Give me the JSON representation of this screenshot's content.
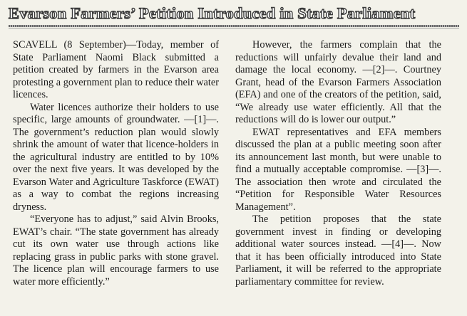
{
  "headline": "Evarson Farmers’ Petition Introduced in State Parliament",
  "left_column": [
    "SCAVELL (8 September)—Today, member of State Parliament Naomi Black submitted a petition created by farmers in the Evarson area protesting a government plan to reduce their water licences.",
    "Water licences authorize their holders to use specific, large amounts of groundwater. —[1]—. The government’s reduction plan would slowly shrink the amount of water that licence-holders in the agricultural industry are entitled to by 10% over the next five years. It was developed by the Evarson Water and Agriculture Taskforce (EWAT) as a way to combat the regions increasing dryness.",
    "“Everyone has to adjust,” said Alvin Brooks, EWAT’s chair. “The state government has already cut its own water use through actions like replacing grass in public parks with stone gravel. The licence plan will encourage farmers to use water more efficiently.”"
  ],
  "right_column": [
    "However, the farmers complain that the reductions will unfairly devalue their land and damage the local economy. —[2]—. Courtney Grant, head of the Evarson Farmers Association (EFA) and one of the creators of the petition, said, “We already use water efficiently. All that the reductions will do is lower our output.”",
    "EWAT representatives and EFA members discussed the plan at a public meeting soon after its announcement last month, but were unable to find a mutually acceptable compromise. —[3]—. The association then wrote and circulated the “Petition for Responsible Water Resources Management”.",
    "The petition proposes that the state government invest in finding or developing additional water sources instead. —[4]—. Now that it has been officially introduced into State Parliament, it will be referred to the appropriate parliamentary committee for review."
  ]
}
